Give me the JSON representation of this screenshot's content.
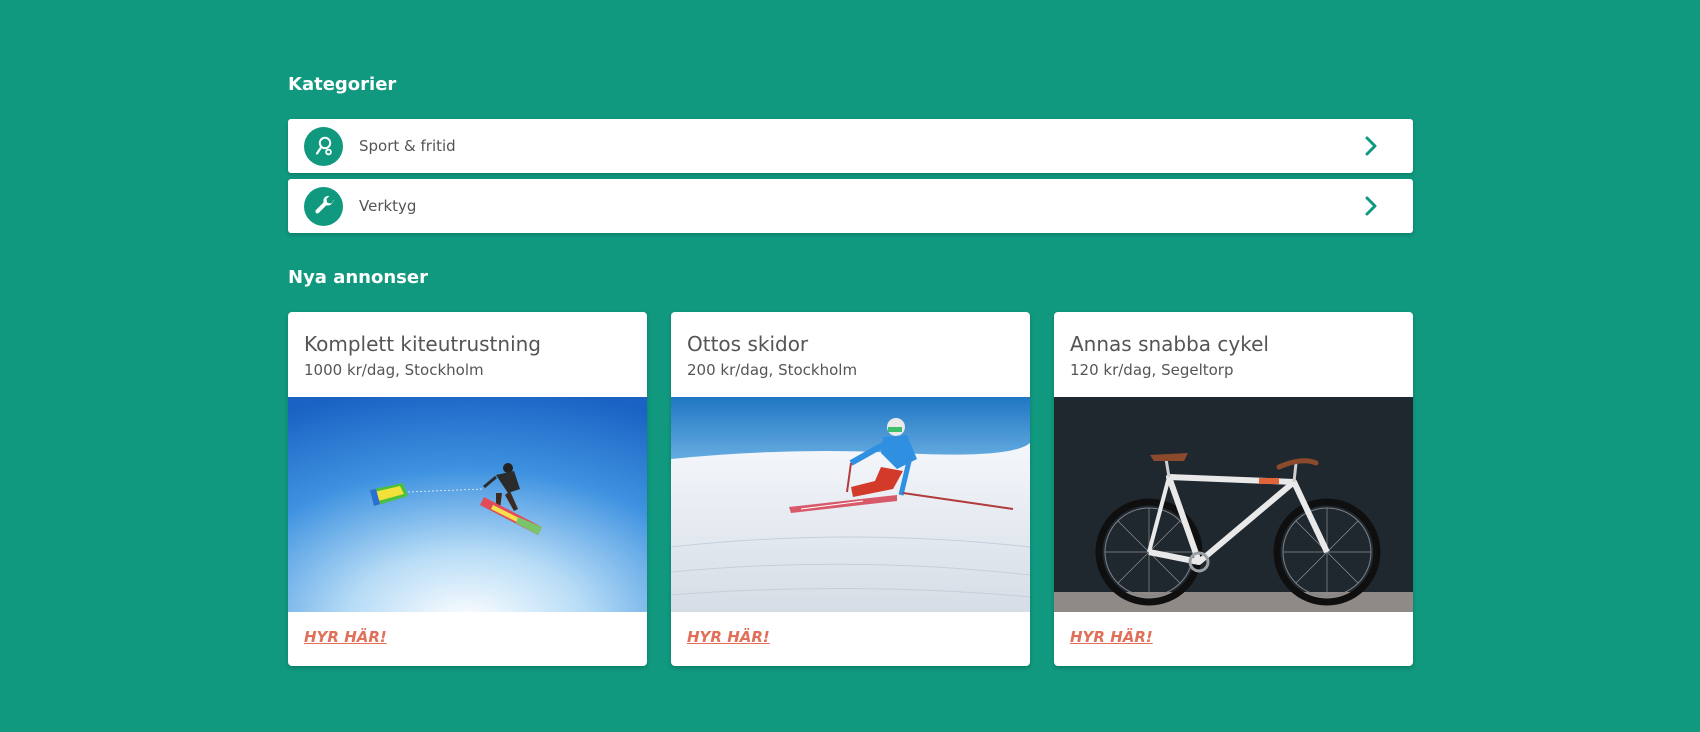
{
  "sections": {
    "categories_title": "Kategorier",
    "ads_title": "Nya annonser"
  },
  "categories": [
    {
      "label": "Sport & fritid",
      "icon": "tennis-racket-icon"
    },
    {
      "label": "Verktyg",
      "icon": "wrench-icon"
    }
  ],
  "ads": [
    {
      "title": "Komplett kiteutrustning",
      "subtitle": "1000 kr/dag, Stockholm",
      "action": "HYR HÄR!",
      "image": "kitesurfer-photo"
    },
    {
      "title": "Ottos skidor",
      "subtitle": "200 kr/dag, Stockholm",
      "action": "HYR HÄR!",
      "image": "skier-photo"
    },
    {
      "title": "Annas snabba cykel",
      "subtitle": "120 kr/dag, Segeltorp",
      "action": "HYR HÄR!",
      "image": "bicycle-photo"
    }
  ],
  "colors": {
    "background": "#10997f",
    "accent": "#10997f",
    "link": "#e0705a",
    "text": "#555555"
  }
}
